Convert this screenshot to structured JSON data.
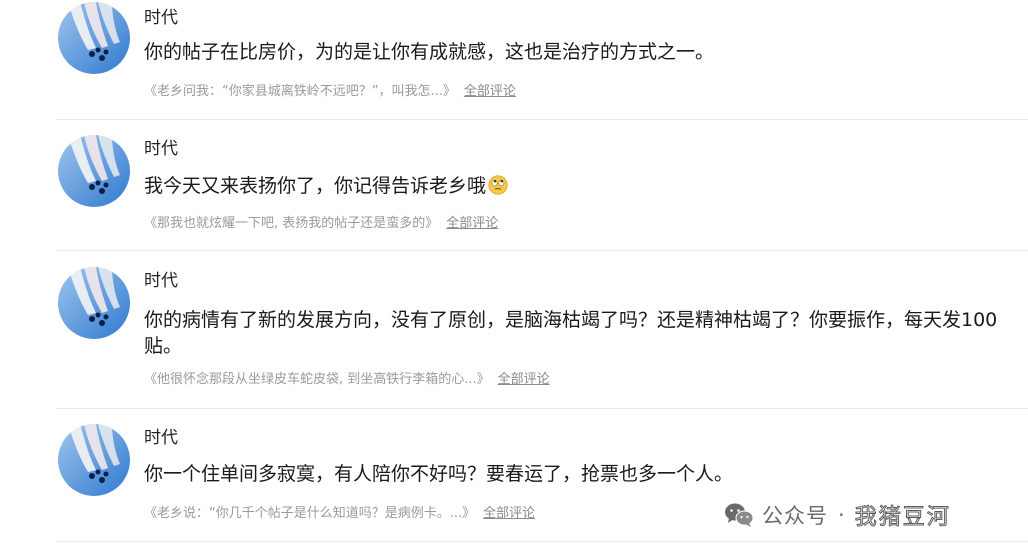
{
  "comments": [
    {
      "user": "时代",
      "text": "你的帖子在比房价，为的是让你有成就感，这也是治疗的方式之一。",
      "reference": "《老乡问我：“你家县城离铁岭不远吧？”，叫我怎...》",
      "link": "全部评论"
    },
    {
      "user": "时代",
      "text": "我今天又来表扬你了，你记得告诉老乡哦",
      "emoji": "rolling-eyes-emoji",
      "reference": "《那我也就炫耀一下吧, 表扬我的帖子还是蛮多的》",
      "link": "全部评论"
    },
    {
      "user": "时代",
      "text": "你的病情有了新的发展方向，没有了原创，是脑海枯竭了吗？还是精神枯竭了？你要振作，每天发100贴。",
      "reference": "《他很怀念那段从坐绿皮车蛇皮袋, 到坐高铁行李箱的心...》",
      "link": "全部评论"
    },
    {
      "user": "时代",
      "text": "你一个住单间多寂寞，有人陪你不好吗？要春运了，抢票也多一个人。",
      "reference": "《老乡说：“你几千个帖子是什么知道吗？是病例卡。...》",
      "link": "全部评论"
    }
  ],
  "watermark": {
    "icon": "wechat-icon",
    "label": "公众号",
    "separator": "·",
    "account": "我猪豆河"
  },
  "colors": {
    "text": "#1a1a1a",
    "meta": "#9a9a9a",
    "divider": "#ececec",
    "avatar_sky": "#3f86d6"
  }
}
